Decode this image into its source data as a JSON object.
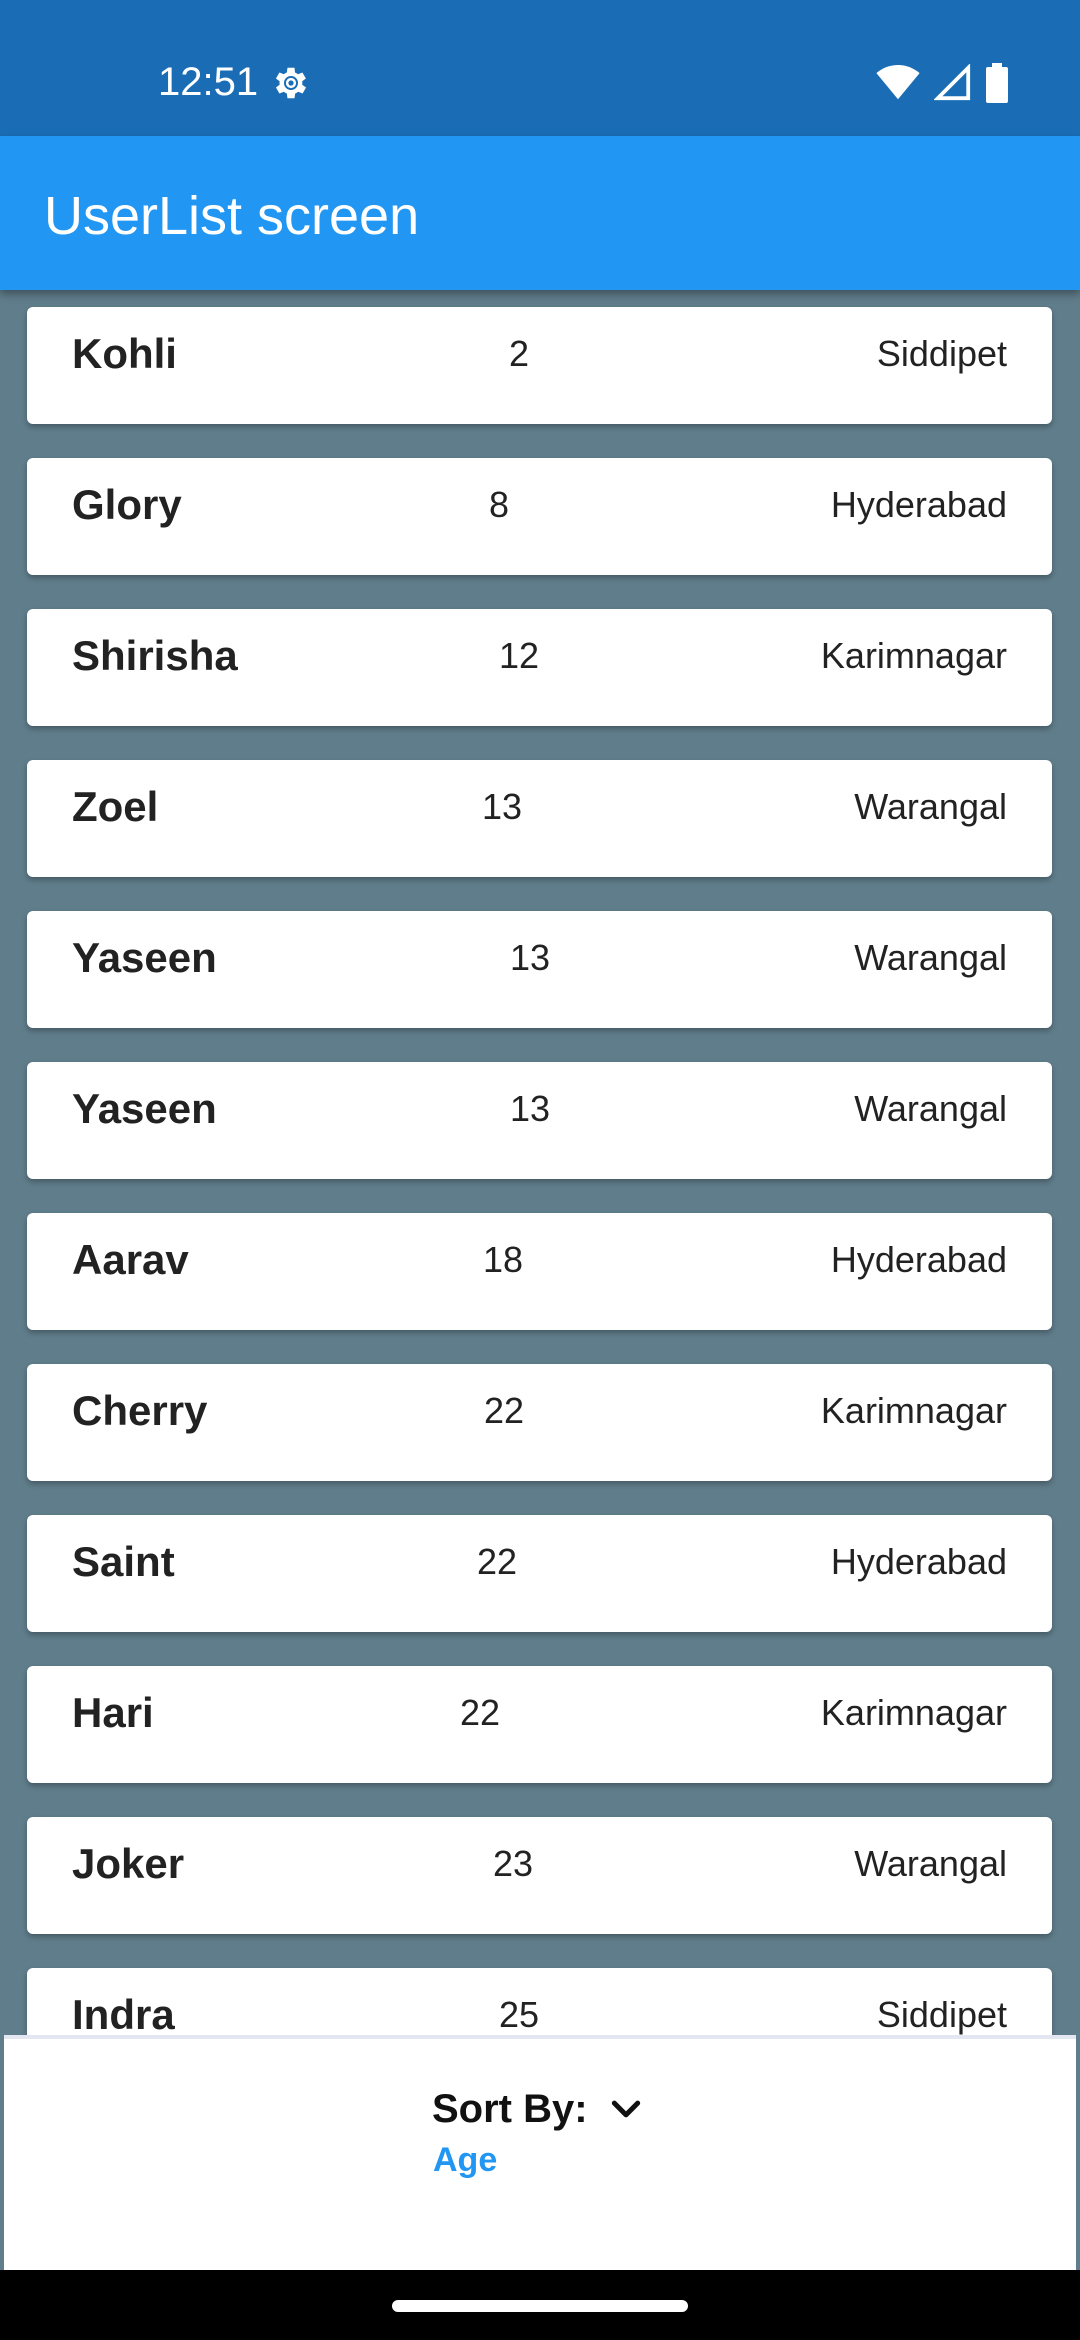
{
  "status_bar": {
    "time": "12:51",
    "icons": [
      "settings-gear-icon",
      "wifi-icon",
      "cellular-signal-icon",
      "battery-icon"
    ]
  },
  "app_bar": {
    "title": "UserList screen",
    "color": "#2196f3"
  },
  "users": [
    {
      "name": "Kohli",
      "age": "2",
      "city": "Siddipet"
    },
    {
      "name": "Glory",
      "age": "8",
      "city": "Hyderabad"
    },
    {
      "name": "Shirisha",
      "age": "12",
      "city": "Karimnagar"
    },
    {
      "name": "Zoel",
      "age": "13",
      "city": "Warangal"
    },
    {
      "name": "Yaseen",
      "age": "13",
      "city": "Warangal"
    },
    {
      "name": "Yaseen",
      "age": "13",
      "city": "Warangal"
    },
    {
      "name": "Aarav",
      "age": "18",
      "city": "Hyderabad"
    },
    {
      "name": "Cherry",
      "age": "22",
      "city": "Karimnagar"
    },
    {
      "name": "Saint",
      "age": "22",
      "city": "Hyderabad"
    },
    {
      "name": "Hari",
      "age": "22",
      "city": "Karimnagar"
    },
    {
      "name": "Joker",
      "age": "23",
      "city": "Warangal"
    },
    {
      "name": "Indra",
      "age": "25",
      "city": "Siddipet"
    }
  ],
  "sort": {
    "label": "Sort By:",
    "value": "Age",
    "value_color": "#2196f3"
  }
}
